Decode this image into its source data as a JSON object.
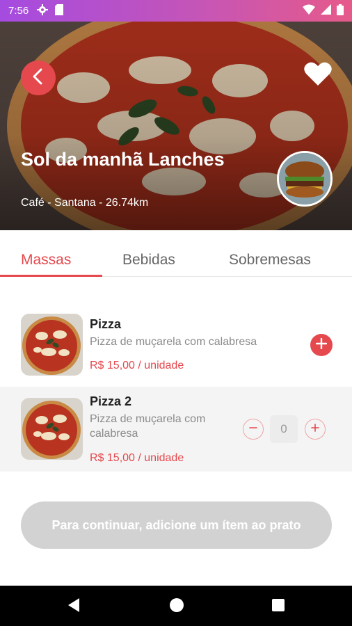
{
  "status_bar": {
    "time": "7:56"
  },
  "header": {
    "store_name": "Sol da manhã Lanches",
    "store_meta": "Café - Santana - 26.74km"
  },
  "tabs": [
    {
      "label": "Massas",
      "active": true
    },
    {
      "label": "Bebidas",
      "active": false
    },
    {
      "label": "Sobremesas",
      "active": false
    }
  ],
  "items": [
    {
      "name": "Pizza",
      "description": "Pizza de muçarela com calabresa",
      "price": "R$ 15,00 / unidade"
    },
    {
      "name": "Pizza 2",
      "description": "Pizza de muçarela com calabresa",
      "price": "R$ 15,00 / unidade",
      "quantity": "0"
    }
  ],
  "continue_button": {
    "label": "Para continuar, adicione um ítem ao prato"
  },
  "icons": {
    "back": "chevron-left-icon",
    "favorite": "heart-icon",
    "add": "plus-icon",
    "minus": "minus-icon"
  },
  "colors": {
    "accent": "#e5484d",
    "status_bar_start": "#a54be0",
    "status_bar_end": "#e65a8a",
    "disabled_button": "#d2d2d2"
  }
}
